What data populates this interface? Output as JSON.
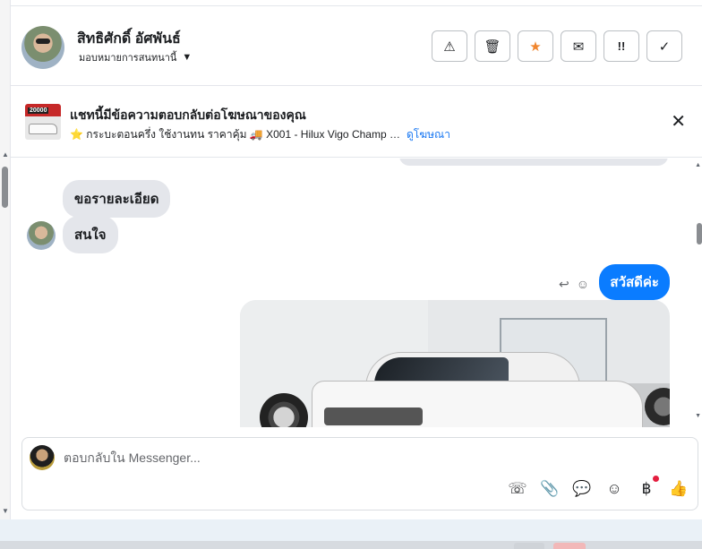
{
  "header": {
    "contact_name": "สิทธิศักดิ์ อัศพันธ์",
    "assign_label": "มอบหมายการสนทนานี้",
    "actions": [
      {
        "name": "spam-button",
        "icon": "warning-icon",
        "glyph": "⚠"
      },
      {
        "name": "delete-button",
        "icon": "trash-icon",
        "glyph": "🗑"
      },
      {
        "name": "follow-up-button",
        "icon": "star-icon",
        "glyph": "★"
      },
      {
        "name": "mark-unread-button",
        "icon": "envelope-icon",
        "glyph": "✉"
      },
      {
        "name": "priority-button",
        "icon": "priority-icon",
        "glyph": "!!"
      },
      {
        "name": "mark-done-button",
        "icon": "check-icon",
        "glyph": "✓"
      }
    ]
  },
  "ad_banner": {
    "thumb_price": "20000",
    "title": "แชทนี้มีข้อความตอบกลับต่อโฆษณาของคุณ",
    "description": "⭐ กระบะตอนครึ่ง ใช้งานทน ราคาคุ้ม 🚚 X001 - Hilux Vigo Champ Ca...",
    "link": "ดูโฆษณา",
    "close": "✕"
  },
  "thread": {
    "incoming": [
      "ขอรายละเอียด",
      "สนใจ"
    ],
    "outgoing": "สวัสดีค่ะ",
    "reply_icon": "↩",
    "react_icon": "☺"
  },
  "composer": {
    "placeholder": "ตอบกลับใน Messenger...",
    "tools": [
      {
        "name": "add-call-icon",
        "glyph": "☏"
      },
      {
        "name": "attachment-icon",
        "glyph": "📎"
      },
      {
        "name": "saved-replies-icon",
        "glyph": "💬"
      },
      {
        "name": "emoji-icon",
        "glyph": "☺"
      },
      {
        "name": "payment-icon",
        "glyph": "฿"
      },
      {
        "name": "like-icon",
        "glyph": "👍"
      }
    ]
  },
  "colors": {
    "accent": "#0a7cff",
    "star": "#f0852d",
    "notification_dot": "#e41e3f"
  }
}
